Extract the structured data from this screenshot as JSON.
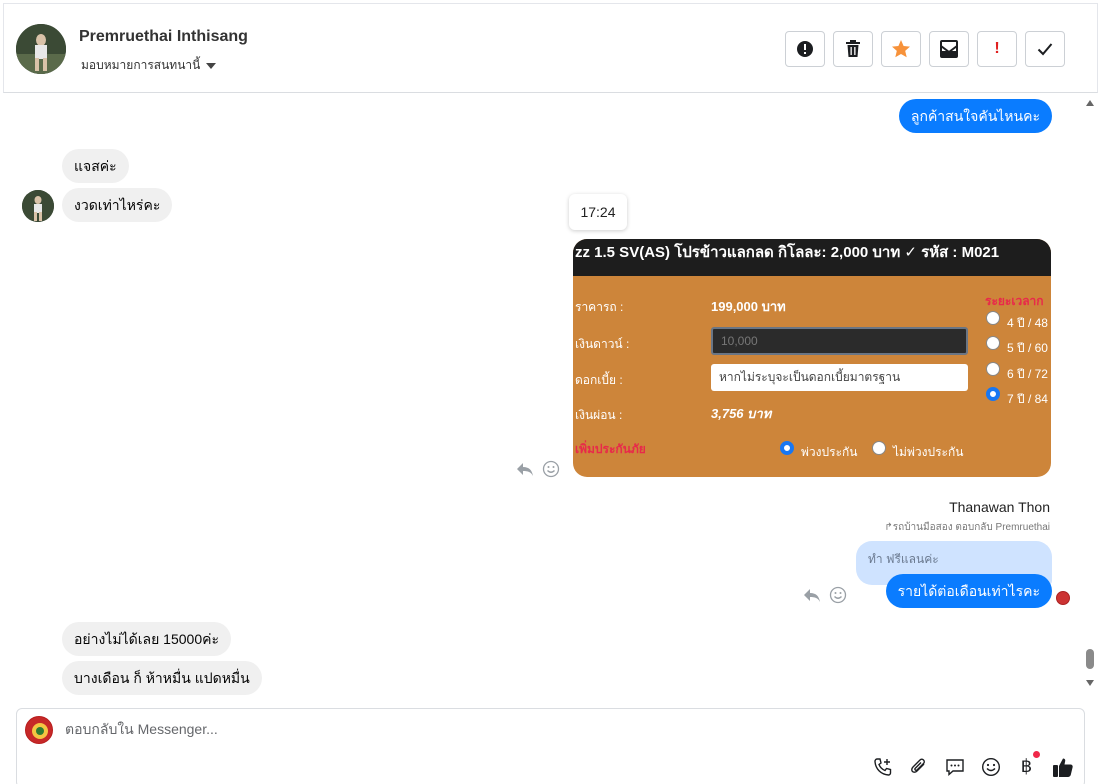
{
  "header": {
    "contact_name": "Premruethai Inthisang",
    "assign_label": "มอบหมายการสนทนานี้",
    "actions": [
      {
        "name": "report-button",
        "icon": "alert-circle-icon"
      },
      {
        "name": "delete-button",
        "icon": "trash-icon"
      },
      {
        "name": "star-button",
        "icon": "star-icon"
      },
      {
        "name": "mark-unread-button",
        "icon": "envelope-icon"
      },
      {
        "name": "priority-button",
        "label": "!"
      },
      {
        "name": "done-button",
        "icon": "check-icon"
      }
    ]
  },
  "messages": {
    "out_1": "ลูกค้าสนใจคันไหนคะ",
    "in_1": "แจสค่ะ",
    "in_2": "งวดเท่าไหร่คะ",
    "timestamp": "17:24",
    "out_2": "รายได้ต่อเดือนเท่าไรคะ",
    "in_3": "อย่างไม่ได้เลย 15000ค่ะ",
    "in_4": "บางเดือน ก็ ห้าหมื่น  แปดหมื่น"
  },
  "card": {
    "title": "zz 1.5 SV(AS) โปรข้าวแลกลด กิโลละ: 2,000 บาท ✓ รหัส : M021",
    "price_label": "ราคารถ :",
    "price_value": "199,000 บาท",
    "down_label": "เงินดาวน์ :",
    "down_value": "10,000",
    "interest_label": "ดอกเบี้ย :",
    "interest_placeholder": "หากไม่ระบุจะเป็นดอกเบี้ยมาตรฐาน",
    "installment_label": "เงินผ่อน :",
    "installment_value": "3,756 บาท",
    "insurance_label": "เพิ่มประกันภัย",
    "insurance_yes": "พ่วงประกัน",
    "insurance_no": "ไม่พ่วงประกัน",
    "period_label": "ระยะเวลาก",
    "periods": [
      "4 ปี / 48",
      "5 ปี / 60",
      "6 ปี / 72",
      "7 ปี / 84"
    ],
    "selected_period": 3
  },
  "reply": {
    "sender_name": "Thanawan Thon",
    "meta": "รถบ้านมือสอง ตอบกลับ Premruethai",
    "quoted": "ทำ ฟรีแลนค่ะ"
  },
  "composer": {
    "placeholder": "ตอบกลับใน Messenger..."
  },
  "colors": {
    "accent": "#0a7cff",
    "card_bg": "#cd853a",
    "star": "#f7923a",
    "priority": "#e02020"
  }
}
